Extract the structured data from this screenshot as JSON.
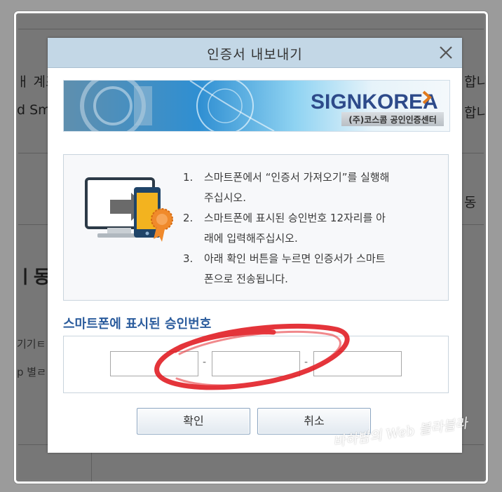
{
  "background_page": {
    "fragments": {
      "left_1": "ㅐ 계조",
      "left_2": "d Sm",
      "right_1": "합니",
      "right_2": "합니다",
      "right_3": "동",
      "heading_left": "ㅣ동",
      "left_3": "기기ㅌ",
      "left_4": "p 별ㄹ"
    }
  },
  "dialog": {
    "title": "인증서 내보내기",
    "close_symbol": "✕",
    "banner": {
      "brand": "SIGNKOREA",
      "subtitle": "(주)코스콤 공인인증센터",
      "brand_color": "#2d4a8a",
      "accent_color": "#e07a1e"
    },
    "instructions": [
      {
        "num": "1.",
        "line1": "스마트폰에서 “인증서 가져오기”를 실행해",
        "line2": "주십시오."
      },
      {
        "num": "2.",
        "line1": "스마트폰에 표시된 승인번호 12자리를 아",
        "line2": "래에 입력해주십시오."
      },
      {
        "num": "3.",
        "line1": "아래 확인 버튼을 누르면 인증서가 스마트",
        "line2": "폰으로 전송됩니다."
      }
    ],
    "code_section_title": "스마트폰에 표시된 승인번호",
    "code_inputs": [
      "",
      "",
      ""
    ],
    "separator": "-",
    "confirm_label": "확인",
    "cancel_label": "취소"
  },
  "annotation": {
    "watermark": "바하밤의 Web 블라블라",
    "circle_color": "#e0181f"
  }
}
